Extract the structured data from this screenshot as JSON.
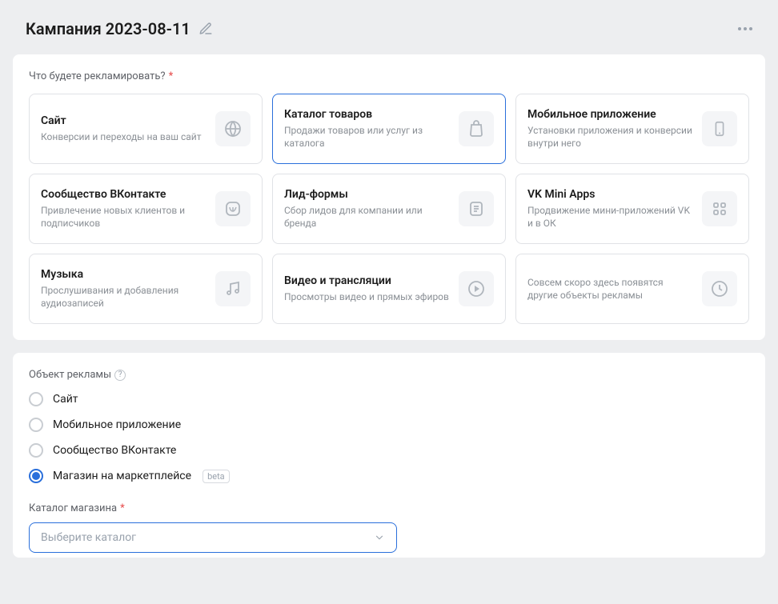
{
  "header": {
    "title": "Кампания 2023-08-11"
  },
  "section_promote": {
    "label": "Что будете рекламировать?"
  },
  "cards": [
    {
      "title": "Сайт",
      "desc": "Конверсии и переходы на ваш сайт",
      "icon": "globe"
    },
    {
      "title": "Каталог товаров",
      "desc": "Продажи товаров или услуг из каталога",
      "icon": "bag",
      "selected": true
    },
    {
      "title": "Мобильное приложение",
      "desc": "Установки приложения и конверсии внутри него",
      "icon": "phone"
    },
    {
      "title": "Сообщество ВКонтакте",
      "desc": "Привлечение новых клиентов и подписчиков",
      "icon": "vk"
    },
    {
      "title": "Лид-формы",
      "desc": "Сбор лидов для компании или бренда",
      "icon": "form"
    },
    {
      "title": "VK Mini Apps",
      "desc": "Продвижение мини-приложений VK и в ОК",
      "icon": "grid"
    },
    {
      "title": "Музыка",
      "desc": "Прослушивания и добавления аудиозаписей",
      "icon": "music"
    },
    {
      "title": "Видео и трансляции",
      "desc": "Просмотры видео и прямых эфиров",
      "icon": "play"
    },
    {
      "title": "",
      "desc": "Совсем скоро здесь появятся другие объекты рекламы",
      "icon": "clock",
      "disabled": true
    }
  ],
  "section_object": {
    "label": "Объект рекламы"
  },
  "radios": [
    {
      "label": "Сайт",
      "checked": false
    },
    {
      "label": "Мобильное приложение",
      "checked": false
    },
    {
      "label": "Сообщество ВКонтакте",
      "checked": false
    },
    {
      "label": "Магазин на маркетплейсе",
      "checked": true,
      "beta": "beta"
    }
  ],
  "catalog": {
    "label": "Каталог магазина",
    "placeholder": "Выберите каталог"
  }
}
